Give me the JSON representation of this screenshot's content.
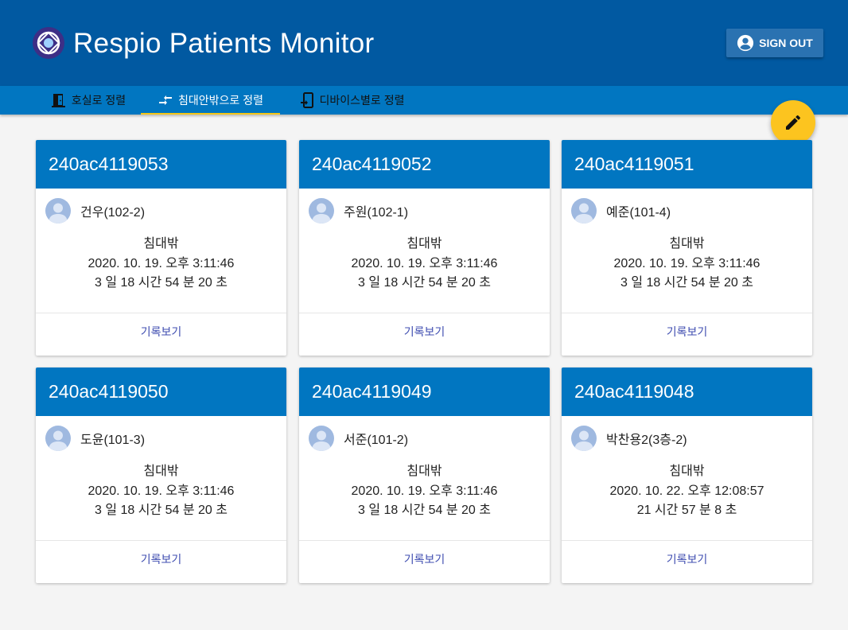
{
  "header": {
    "title": "Respio Patients Monitor",
    "sign_out_label": "SIGN OUT",
    "colors": {
      "header_bg": "#0159a1",
      "tabbar_bg": "#0176c1",
      "accent": "#fcc41f"
    }
  },
  "tabs": [
    {
      "label": "호실로 정렬",
      "icon": "door-icon"
    },
    {
      "label": "침대안밖으로 정렬",
      "icon": "transfer-arrows-icon",
      "active": true
    },
    {
      "label": "디바이스별로 정렬",
      "icon": "device-icon"
    }
  ],
  "fab": {
    "icon": "edit-pencil-icon"
  },
  "cards": [
    {
      "device_id": "240ac4119053",
      "patient": "건우(102-2)",
      "status": "침대밖",
      "timestamp": "2020. 10. 19. 오후 3:11:46",
      "duration": "3 일 18 시간 54 분 20 초",
      "action_label": "기록보기"
    },
    {
      "device_id": "240ac4119052",
      "patient": "주원(102-1)",
      "status": "침대밖",
      "timestamp": "2020. 10. 19. 오후 3:11:46",
      "duration": "3 일 18 시간 54 분 20 초",
      "action_label": "기록보기"
    },
    {
      "device_id": "240ac4119051",
      "patient": "예준(101-4)",
      "status": "침대밖",
      "timestamp": "2020. 10. 19. 오후 3:11:46",
      "duration": "3 일 18 시간 54 분 20 초",
      "action_label": "기록보기"
    },
    {
      "device_id": "240ac4119050",
      "patient": "도윤(101-3)",
      "status": "침대밖",
      "timestamp": "2020. 10. 19. 오후 3:11:46",
      "duration": "3 일 18 시간 54 분 20 초",
      "action_label": "기록보기"
    },
    {
      "device_id": "240ac4119049",
      "patient": "서준(101-2)",
      "status": "침대밖",
      "timestamp": "2020. 10. 19. 오후 3:11:46",
      "duration": "3 일 18 시간 54 분 20 초",
      "action_label": "기록보기"
    },
    {
      "device_id": "240ac4119048",
      "patient": "박찬용2(3층-2)",
      "status": "침대밖",
      "timestamp": "2020. 10. 22. 오후 12:08:57",
      "duration": "21 시간 57 분 8 초",
      "action_label": "기록보기"
    }
  ]
}
